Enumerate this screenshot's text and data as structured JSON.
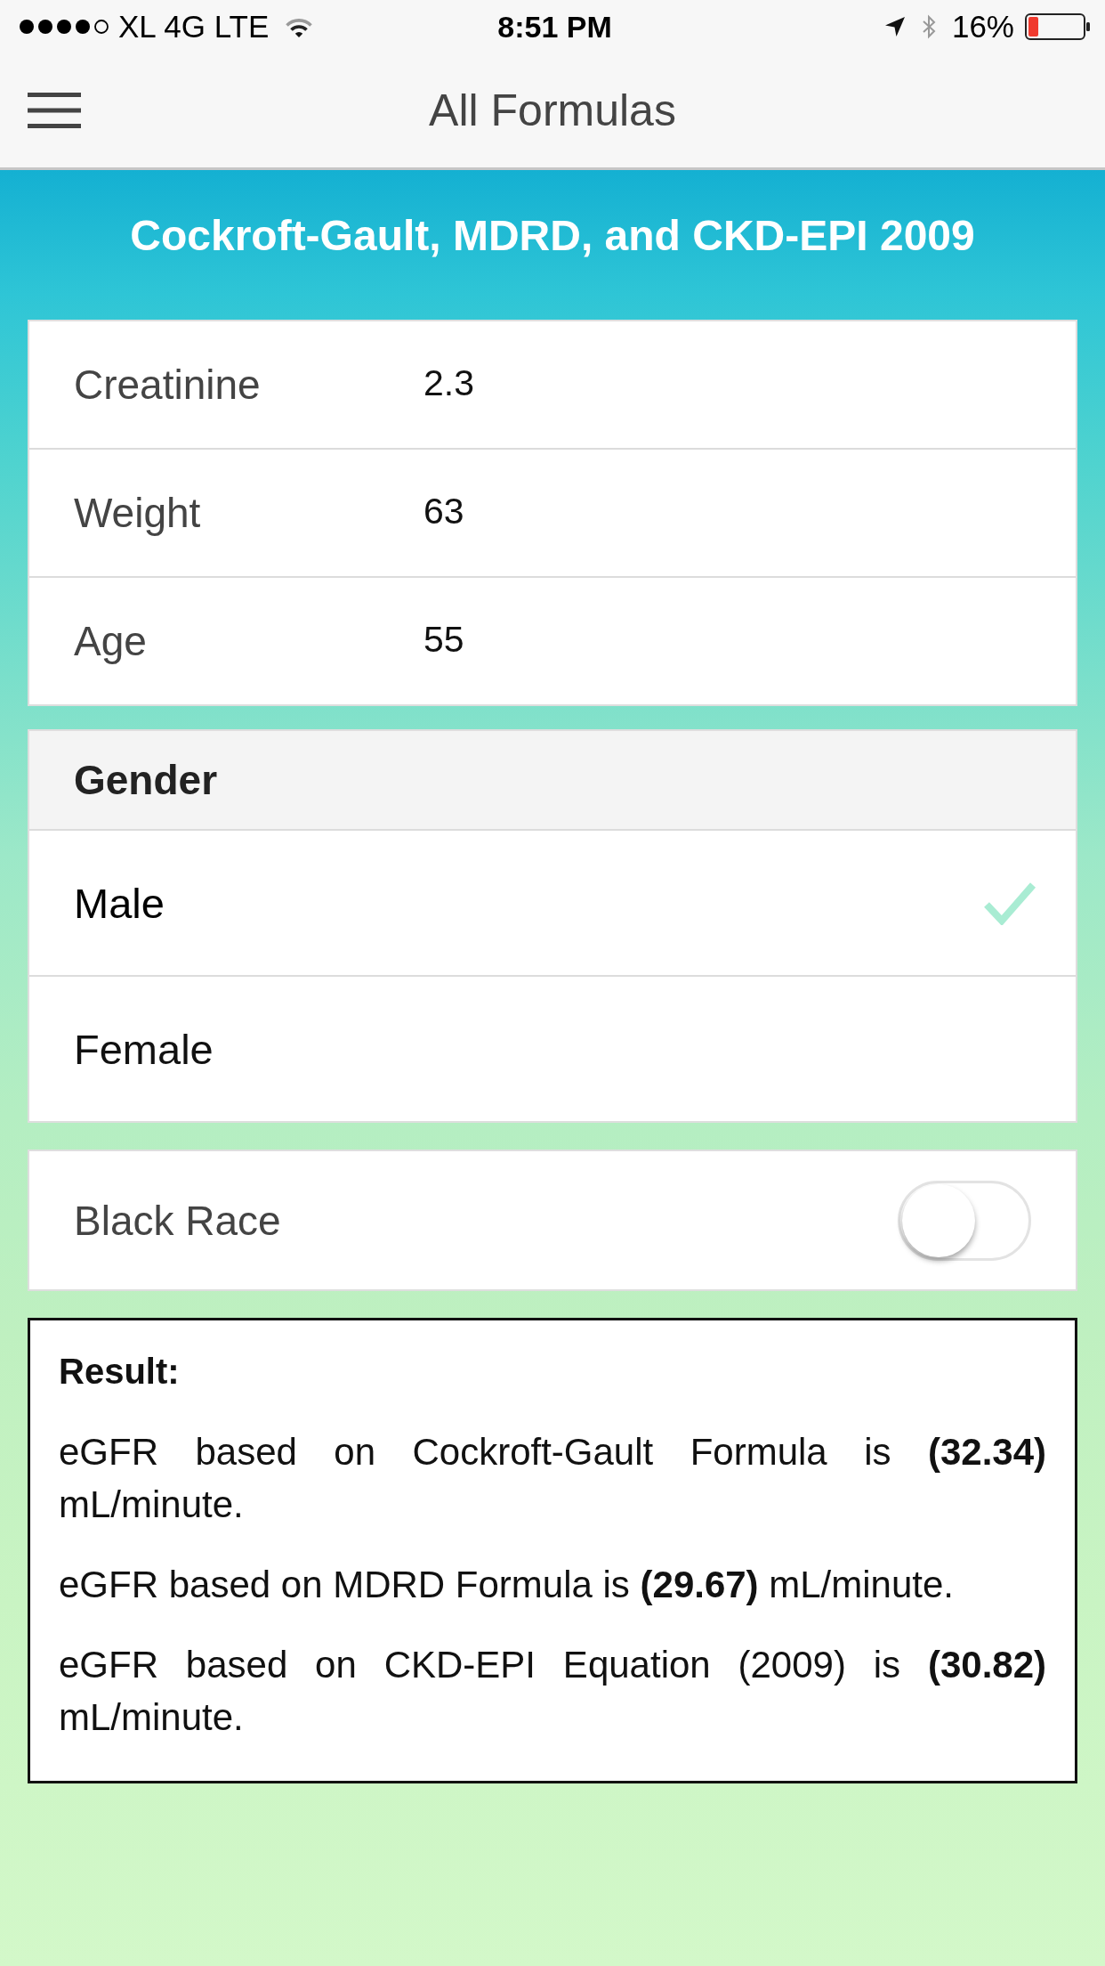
{
  "status_bar": {
    "carrier": "XL 4G LTE",
    "time": "8:51 PM",
    "battery": "16%"
  },
  "nav_bar": {
    "title": "All Formulas"
  },
  "heading": "Cockroft-Gault, MDRD, and CKD-EPI 2009",
  "inputs": [
    {
      "label": "Creatinine",
      "value": "2.3"
    },
    {
      "label": "Weight",
      "value": "63"
    },
    {
      "label": "Age",
      "value": "55"
    }
  ],
  "gender": {
    "title": "Gender",
    "options": [
      {
        "label": "Male",
        "selected": true
      },
      {
        "label": "Female",
        "selected": false
      }
    ]
  },
  "black_race": {
    "label": "Black Race",
    "on": false
  },
  "result": {
    "title": "Result:",
    "lines": [
      "eGFR based on Cockroft-Gault Formula is **(32.34)** mL/minute.",
      "eGFR based on MDRD Formula is **(29.67)** mL/minute.",
      "eGFR based on CKD-EPI Equation (2009) is **(30.82)** mL/minute."
    ]
  }
}
